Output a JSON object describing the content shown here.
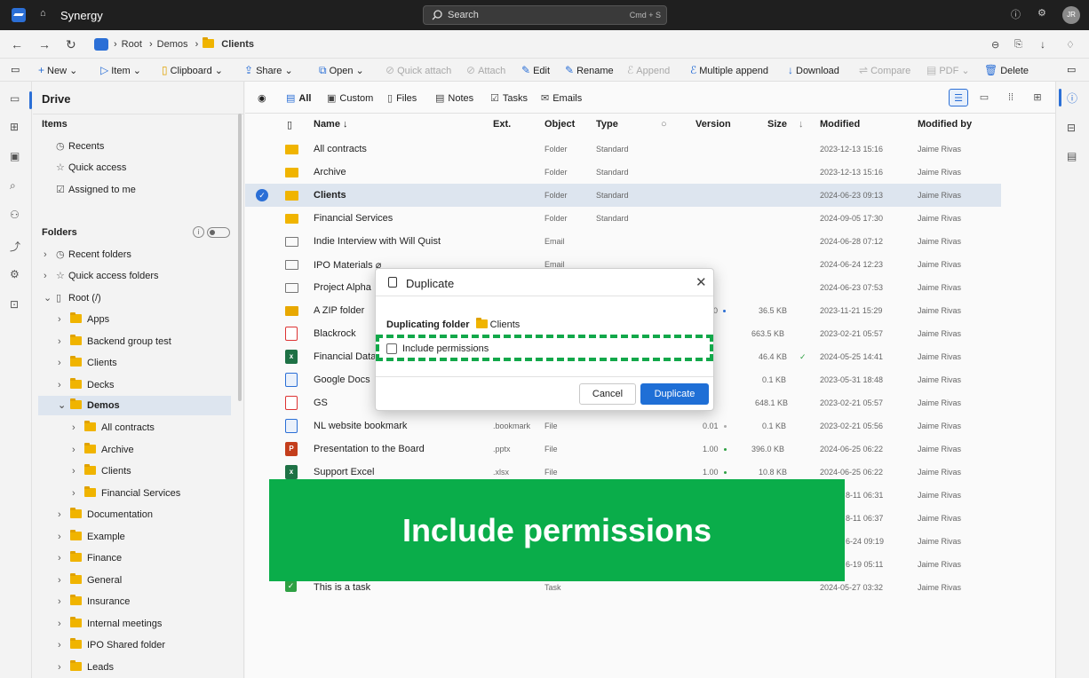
{
  "app": {
    "name": "Synergy",
    "user_initials": "JR"
  },
  "search": {
    "placeholder": "Search",
    "shortcut": "Cmd + S"
  },
  "breadcrumb": [
    "Root",
    "Demos",
    "Clients"
  ],
  "commands": {
    "new": "New",
    "item": "Item",
    "clipboard": "Clipboard",
    "share": "Share",
    "open": "Open",
    "quick_attach": "Quick attach",
    "attach": "Attach",
    "edit": "Edit",
    "rename": "Rename",
    "append": "Append",
    "multiple_append": "Multiple append",
    "download": "Download",
    "compare": "Compare",
    "pdf": "PDF",
    "delete": "Delete"
  },
  "sidebar": {
    "title": "Drive",
    "items_title": "Items",
    "items": [
      "Recents",
      "Quick access",
      "Assigned to me"
    ],
    "folders_title": "Folders",
    "folders_top": [
      "Recent folders",
      "Quick access folders"
    ],
    "root": "Root (/)",
    "tree": [
      "Apps",
      "Backend group test",
      "Clients",
      "Decks",
      "Demos"
    ],
    "demos_children": [
      "All contracts",
      "Archive",
      "Clients",
      "Financial Services"
    ],
    "tree_after": [
      "Documentation",
      "Example",
      "Finance",
      "General",
      "Insurance",
      "Internal meetings",
      "IPO Shared folder",
      "Leads"
    ]
  },
  "view_tabs": [
    "All",
    "Custom",
    "Files",
    "Notes",
    "Tasks",
    "Emails"
  ],
  "columns": {
    "name": "Name",
    "ext": "Ext.",
    "object": "Object",
    "type": "Type",
    "version": "Version",
    "size": "Size",
    "modified": "Modified",
    "modified_by": "Modified by"
  },
  "rows": [
    {
      "name": "All contracts",
      "ext": "",
      "object": "Folder",
      "type": "Standard",
      "version": "",
      "size": "",
      "modified": "2023-12-13 15:16",
      "by": "Jaime Rivas"
    },
    {
      "name": "Archive",
      "ext": "",
      "object": "Folder",
      "type": "Standard",
      "version": "",
      "size": "",
      "modified": "2023-12-13 15:16",
      "by": "Jaime Rivas"
    },
    {
      "name": "Clients",
      "ext": "",
      "object": "Folder",
      "type": "Standard",
      "version": "",
      "size": "",
      "modified": "2024-06-23 09:13",
      "by": "Jaime Rivas"
    },
    {
      "name": "Financial Services",
      "ext": "",
      "object": "Folder",
      "type": "Standard",
      "version": "",
      "size": "",
      "modified": "2024-09-05 17:30",
      "by": "Jaime Rivas"
    },
    {
      "name": "Indie Interview with Will Quist",
      "ext": "",
      "object": "Email",
      "type": "",
      "version": "",
      "size": "",
      "modified": "2024-06-28 07:12",
      "by": "Jaime Rivas"
    },
    {
      "name": "IPO Materials",
      "ext": "",
      "object": "Email",
      "type": "",
      "version": "",
      "size": "",
      "modified": "2024-06-24 12:23",
      "by": "Jaime Rivas"
    },
    {
      "name": "Project Alpha",
      "ext": "",
      "object": "",
      "type": "",
      "version": "",
      "size": "",
      "modified": "2024-06-23 07:53",
      "by": "Jaime Rivas"
    },
    {
      "name": "A ZIP folder",
      "ext": "",
      "object": "",
      "type": "",
      "version": "0",
      "size": "36.5 KB",
      "modified": "2023-11-21 15:29",
      "by": "Jaime Rivas"
    },
    {
      "name": "Blackrock",
      "ext": "",
      "object": "",
      "type": "",
      "version": "",
      "size": "663.5 KB",
      "modified": "2023-02-21 05:57",
      "by": "Jaime Rivas"
    },
    {
      "name": "Financial Data",
      "ext": "",
      "object": "",
      "type": "",
      "version": "",
      "size": "46.4 KB",
      "modified": "2024-05-25 14:41",
      "by": "Jaime Rivas"
    },
    {
      "name": "Google Docs",
      "ext": "",
      "object": "",
      "type": "",
      "version": "",
      "size": "0.1 KB",
      "modified": "2023-05-31 18:48",
      "by": "Jaime Rivas"
    },
    {
      "name": "GS",
      "ext": "",
      "object": "",
      "type": "",
      "version": "",
      "size": "648.1 KB",
      "modified": "2023-02-21 05:57",
      "by": "Jaime Rivas"
    },
    {
      "name": "NL website bookmark",
      "ext": ".bookmark",
      "object": "File",
      "type": "",
      "version": "0.01",
      "size": "0.1 KB",
      "modified": "2023-02-21 05:56",
      "by": "Jaime Rivas"
    },
    {
      "name": "Presentation to the Board",
      "ext": ".pptx",
      "object": "File",
      "type": "",
      "version": "1.00",
      "size": "396.0 KB",
      "modified": "2024-06-25 06:22",
      "by": "Jaime Rivas"
    },
    {
      "name": "Support Excel",
      "ext": ".xlsx",
      "object": "File",
      "type": "",
      "version": "1.00",
      "size": "10.8 KB",
      "modified": "2024-06-25 06:22",
      "by": "Jaime Rivas"
    },
    {
      "name": "",
      "ext": "",
      "object": "",
      "type": "",
      "version": "",
      "size": "",
      "modified": "8-11 06:31",
      "by": "Jaime Rivas"
    },
    {
      "name": "",
      "ext": "",
      "object": "",
      "type": "",
      "version": "",
      "size": "",
      "modified": "8-11 06:37",
      "by": "Jaime Rivas"
    },
    {
      "name": "",
      "ext": "",
      "object": "",
      "type": "",
      "version": "",
      "size": "",
      "modified": "6-24 09:19",
      "by": "Jaime Rivas"
    },
    {
      "name": "",
      "ext": "",
      "object": "",
      "type": "",
      "version": "",
      "size": "",
      "modified": "6-19 05:11",
      "by": "Jaime Rivas"
    },
    {
      "name": "This is a task",
      "ext": "",
      "object": "Task",
      "type": "",
      "version": "",
      "size": "",
      "modified": "2024-05-27 03:32",
      "by": "Jaime Rivas"
    }
  ],
  "dialog": {
    "title": "Duplicate",
    "description_label": "Duplicating folder",
    "folder_name": "Clients",
    "checkbox_label": "Include permissions",
    "checkbox_checked": false,
    "cancel": "Cancel",
    "confirm": "Duplicate"
  },
  "banner": {
    "text": "Include permissions"
  },
  "colors": {
    "accent": "#1f6fd6",
    "banner": "#0aad4a",
    "folder": "#f0b400",
    "selected_row": "#dde5ef"
  }
}
